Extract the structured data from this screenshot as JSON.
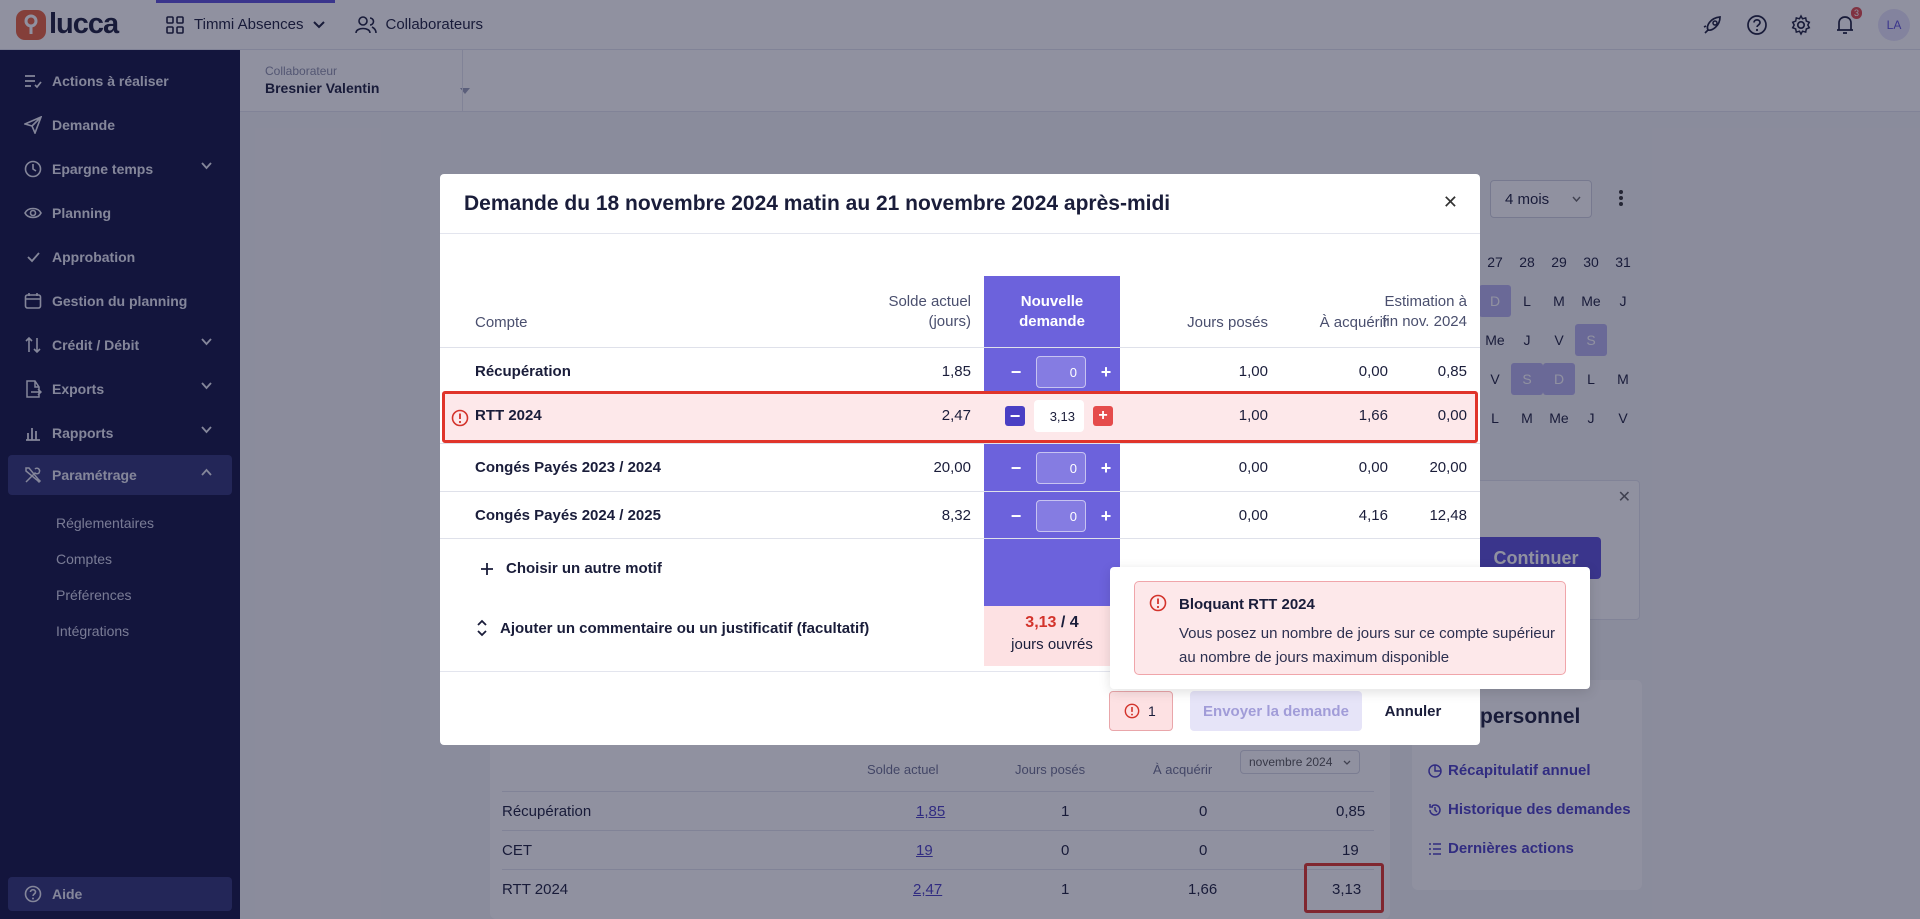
{
  "topbar": {
    "logo": "lucca",
    "app_selector": "Timmi Absences",
    "collaborators_link": "Collaborateurs",
    "notification_count": "3",
    "avatar_initials": "LA"
  },
  "sidebar": {
    "items": [
      {
        "label": "Actions à réaliser",
        "icon": "checklist-icon"
      },
      {
        "label": "Demande",
        "icon": "paper-plane-icon"
      },
      {
        "label": "Epargne temps",
        "icon": "clock-icon",
        "has_chevron": true
      },
      {
        "label": "Planning",
        "icon": "eye-icon"
      },
      {
        "label": "Approbation",
        "icon": "check-icon"
      },
      {
        "label": "Gestion du planning",
        "icon": "calendar-icon"
      },
      {
        "label": "Crédit / Débit",
        "icon": "swap-icon",
        "has_chevron": true
      },
      {
        "label": "Exports",
        "icon": "export-icon",
        "has_chevron": true
      },
      {
        "label": "Rapports",
        "icon": "chart-icon",
        "has_chevron": true
      },
      {
        "label": "Paramétrage",
        "icon": "tools-icon",
        "has_chevron": true,
        "active": true
      }
    ],
    "subitems": [
      "Réglementaires",
      "Comptes",
      "Préférences",
      "Intégrations"
    ],
    "help": "Aide"
  },
  "collaborator": {
    "label": "Collaborateur",
    "value": "Bresnier Valentin"
  },
  "background": {
    "period_select": "4 mois",
    "calendar": {
      "days": [
        "27",
        "28",
        "29",
        "30",
        "31"
      ],
      "rows": [
        [
          "D",
          "L",
          "M",
          "Me",
          "J"
        ],
        [
          "Me",
          "J",
          "V",
          "S"
        ],
        [
          "V",
          "S",
          "D",
          "L",
          "M"
        ],
        [
          "L",
          "M",
          "Me",
          "J",
          "V"
        ]
      ]
    },
    "continue_button": "Continuer",
    "personal": {
      "title": "personnel",
      "links": [
        "Récapitulatif annuel",
        "Historique des demandes",
        "Dernières actions"
      ]
    },
    "balance_table": {
      "headers": [
        "Solde actuel",
        "Jours posés",
        "À acquérir"
      ],
      "month_select": "novembre 2024",
      "rows": [
        {
          "name": "Récupération",
          "solde": "1,85",
          "poses": "1",
          "acquerir": "0",
          "fin": "0,85"
        },
        {
          "name": "CET",
          "solde": "19",
          "poses": "0",
          "acquerir": "0",
          "fin": "19"
        },
        {
          "name": "RTT 2024",
          "solde": "2,47",
          "poses": "1",
          "acquerir": "1,66",
          "fin": "3,13"
        }
      ]
    }
  },
  "modal": {
    "title": "Demande du 18 novembre 2024 matin au 21 novembre 2024 après-midi",
    "headers": {
      "compte": "Compte",
      "solde_line1": "Solde actuel",
      "solde_line2": "(jours)",
      "new_line1": "Nouvelle",
      "new_line2": "demande",
      "poses": "Jours posés",
      "acquerir": "À acquérir",
      "estim_line1": "Estimation à",
      "estim_line2": "fin nov. 2024"
    },
    "rows": [
      {
        "name": "Récupération",
        "solde": "1,85",
        "value": "0",
        "poses": "1,00",
        "acquerir": "0,00",
        "estim": "0,85"
      },
      {
        "name": "RTT 2024",
        "solde": "2,47",
        "value": "3,13",
        "poses": "1,00",
        "acquerir": "1,66",
        "estim": "0,00",
        "error": true
      },
      {
        "name": "Congés Payés 2023 / 2024",
        "solde": "20,00",
        "value": "0",
        "poses": "0,00",
        "acquerir": "0,00",
        "estim": "20,00"
      },
      {
        "name": "Congés Payés 2024 / 2025",
        "solde": "8,32",
        "value": "0",
        "poses": "0,00",
        "acquerir": "4,16",
        "estim": "12,48"
      }
    ],
    "total": {
      "value": "3,13",
      "separator": " / ",
      "max": "4",
      "unit": "jours ouvrés"
    },
    "add_motif": "Choisir un autre motif",
    "add_comment": "Ajouter un commentaire ou un justificatif (facultatif)",
    "error_count": "1",
    "send_button": "Envoyer la demande",
    "cancel_button": "Annuler"
  },
  "popover": {
    "title": "Bloquant RTT 2024",
    "text": "Vous posez un nombre de jours sur ce compte supérieur au nombre de jours maximum disponible"
  },
  "colors": {
    "accent": "#5b4fd9",
    "sidebar": "#111342",
    "error": "#e0342a"
  }
}
